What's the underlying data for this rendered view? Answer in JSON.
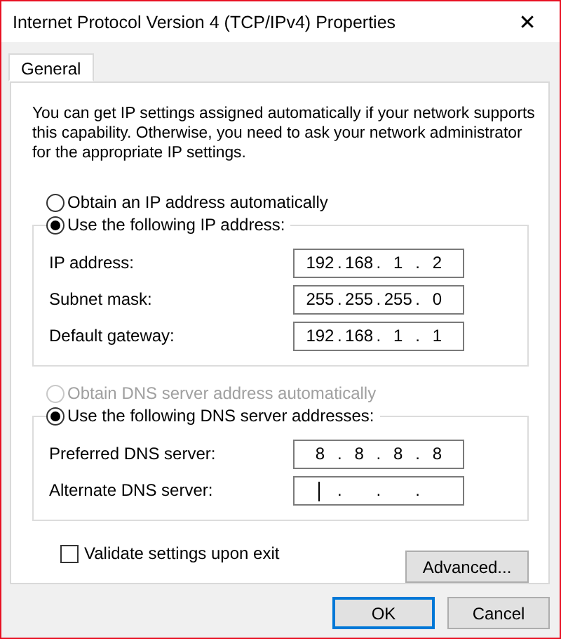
{
  "window": {
    "title": "Internet Protocol Version 4 (TCP/IPv4) Properties",
    "close": "✕"
  },
  "tabs": [
    {
      "label": "General",
      "selected": true
    }
  ],
  "description": "You can get IP settings assigned automatically if your network supports this capability. Otherwise, you need to ask your network administrator for the appropriate IP settings.",
  "sections": [
    {
      "auto_option": {
        "label": "Obtain an IP address automatically",
        "selected": false,
        "disabled": false
      },
      "manual_option": {
        "label": "Use the following IP address:",
        "selected": true,
        "disabled": false
      },
      "fields": [
        {
          "label": "IP address:",
          "octets": [
            "192",
            "168",
            "1",
            "2"
          ],
          "focused": false
        },
        {
          "label": "Subnet mask:",
          "octets": [
            "255",
            "255",
            "255",
            "0"
          ],
          "focused": false
        },
        {
          "label": "Default gateway:",
          "octets": [
            "192",
            "168",
            "1",
            "1"
          ],
          "focused": false
        }
      ]
    },
    {
      "auto_option": {
        "label": "Obtain DNS server address automatically",
        "selected": false,
        "disabled": true
      },
      "manual_option": {
        "label": "Use the following DNS server addresses:",
        "selected": true,
        "disabled": false
      },
      "fields": [
        {
          "label": "Preferred DNS server:",
          "octets": [
            "8",
            "8",
            "8",
            "8"
          ],
          "focused": false
        },
        {
          "label": "Alternate DNS server:",
          "focused": true
        }
      ]
    }
  ],
  "separator": ".",
  "validate": {
    "label": "Validate settings upon exit",
    "checked": false
  },
  "advanced_button": "Advanced...",
  "buttons": [
    {
      "label": "OK",
      "default": true
    },
    {
      "label": "Cancel",
      "default": false
    }
  ]
}
